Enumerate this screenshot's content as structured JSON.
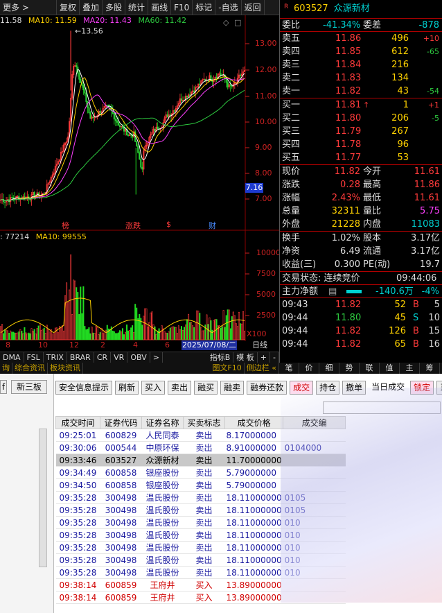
{
  "toolbar": {
    "more": "更多 >",
    "buttons": [
      "复权",
      "叠加",
      "多股",
      "统计",
      "画线",
      "F10",
      "标记",
      "-自选",
      "返回"
    ]
  },
  "ma_legend": {
    "ma5": "11.58",
    "ma10": "MA10: 11.59",
    "ma20": "MA20: 11.43",
    "ma60": "MA60: 11.42"
  },
  "price_axis": [
    "13.00",
    "12.00",
    "11.00",
    "10.00",
    "9.00",
    "8.00",
    "7.00"
  ],
  "high_label": "13.56",
  "last_price_chip": "7.16",
  "event_markers": [
    "榜",
    "涨跌",
    "$",
    "财"
  ],
  "vol_legend": {
    "v1": ": 77214",
    "v2": "MA10: 99555"
  },
  "vol_axis": [
    "10000",
    "7500",
    "5000",
    "2500",
    "X100"
  ],
  "x_ticks": [
    "8",
    "10",
    "12",
    "2",
    "4",
    "6"
  ],
  "date_chip": "2025/07/08/二",
  "day_label": "日线",
  "indicators": [
    "DMA",
    "FSL",
    "TRIX",
    "BRAR",
    "CR",
    "VR",
    "OBV",
    ">",
    "指标B",
    "模 板",
    "+",
    "-"
  ],
  "tabs": [
    "询",
    "综合资讯",
    "板块资讯",
    "图文F10",
    "侧边栏 «"
  ],
  "quote": {
    "code": "603527",
    "name": "众源新材",
    "ratio_label": "委比",
    "ratio": "-41.34%",
    "diff_label": "委差",
    "diff": "-878",
    "asks": [
      {
        "label": "卖五",
        "price": "11.86",
        "vol": "496",
        "chg": "+10"
      },
      {
        "label": "卖四",
        "price": "11.85",
        "vol": "612",
        "chg": "-65"
      },
      {
        "label": "卖三",
        "price": "11.84",
        "vol": "216",
        "chg": ""
      },
      {
        "label": "卖二",
        "price": "11.83",
        "vol": "134",
        "chg": ""
      },
      {
        "label": "卖一",
        "price": "11.82",
        "vol": "43",
        "chg": "-54"
      }
    ],
    "bids": [
      {
        "label": "买一",
        "price": "11.81",
        "vol": "1",
        "chg": "+1"
      },
      {
        "label": "买二",
        "price": "11.80",
        "vol": "206",
        "chg": "-5"
      },
      {
        "label": "买三",
        "price": "11.79",
        "vol": "267",
        "chg": ""
      },
      {
        "label": "买四",
        "price": "11.78",
        "vol": "96",
        "chg": ""
      },
      {
        "label": "买五",
        "price": "11.77",
        "vol": "53",
        "chg": ""
      }
    ],
    "stats": [
      {
        "l1": "现价",
        "v1": "11.82",
        "l2": "今开",
        "v2": "11.61"
      },
      {
        "l1": "涨跌",
        "v1": "0.28",
        "l2": "最高",
        "v2": "11.86"
      },
      {
        "l1": "涨幅",
        "v1": "2.43%",
        "l2": "最低",
        "v2": "11.61"
      },
      {
        "l1": "总量",
        "v1": "32311",
        "l2": "量比",
        "v2": "5.75"
      },
      {
        "l1": "外盘",
        "v1": "21228",
        "l2": "内盘",
        "v2": "11083"
      }
    ],
    "stats2": [
      {
        "l1": "换手",
        "v1": "1.02%",
        "l2": "股本",
        "v2": "3.17亿"
      },
      {
        "l1": "净资",
        "v1": "6.49",
        "l2": "流通",
        "v2": "3.17亿"
      },
      {
        "l1": "收益(三)",
        "v1": "0.300",
        "l2": "PE(动)",
        "v2": "19.7"
      }
    ],
    "status_label": "交易状态: 连续竞价",
    "status_time": "09:44:06",
    "main_flow_label": "主力净额",
    "main_flow": "-140.6万",
    "main_flow_pct": "-4%",
    "ticks": [
      {
        "time": "09:43",
        "price": "11.82",
        "vol": "52",
        "side": "B",
        "n": "5"
      },
      {
        "time": "09:44",
        "price": "11.80",
        "vol": "45",
        "side": "S",
        "n": "10"
      },
      {
        "time": "09:44",
        "price": "11.82",
        "vol": "126",
        "side": "B",
        "n": "15"
      },
      {
        "time": "09:44",
        "price": "11.82",
        "vol": "65",
        "side": "B",
        "n": "16"
      }
    ]
  },
  "rp_tabs": [
    "笔",
    "价",
    "细",
    "势",
    "联",
    "值",
    "主",
    "筹"
  ],
  "bottom": {
    "left_buttons": [
      "f",
      "新三板"
    ],
    "buttons": [
      "安全信息提示",
      "刷新",
      "买入",
      "卖出",
      "融买",
      "融卖",
      "融券还款",
      "成交",
      "持仓",
      "撤单",
      "当日成交",
      "锁定",
      "系统"
    ],
    "columns": [
      "成交时间",
      "证券代码",
      "证券名称",
      "买卖标志",
      "成交价格",
      "成交编"
    ],
    "rows": [
      {
        "time": "09:25:01",
        "code": "600829",
        "name": "人民同泰",
        "flag": "卖出",
        "price": "8.17000000",
        "extra": "",
        "type": "blue"
      },
      {
        "time": "09:30:06",
        "code": "000544",
        "name": "中原环保",
        "flag": "卖出",
        "price": "8.91000000",
        "extra": "0104000",
        "type": "blue"
      },
      {
        "time": "09:33:46",
        "code": "603527",
        "name": "众源新材",
        "flag": "卖出",
        "price": "11.70000000",
        "extra": "",
        "type": "sel"
      },
      {
        "time": "09:34:49",
        "code": "600858",
        "name": "银座股份",
        "flag": "卖出",
        "price": "5.79000000",
        "extra": "",
        "type": "blue"
      },
      {
        "time": "09:34:50",
        "code": "600858",
        "name": "银座股份",
        "flag": "卖出",
        "price": "5.79000000",
        "extra": "",
        "type": "blue"
      },
      {
        "time": "09:35:28",
        "code": "300498",
        "name": "温氏股份",
        "flag": "卖出",
        "price": "18.11000000",
        "extra": "0105",
        "type": "blue"
      },
      {
        "time": "09:35:28",
        "code": "300498",
        "name": "温氏股份",
        "flag": "卖出",
        "price": "18.11000000",
        "extra": "0105",
        "type": "blue"
      },
      {
        "time": "09:35:28",
        "code": "300498",
        "name": "温氏股份",
        "flag": "卖出",
        "price": "18.11000000",
        "extra": "010",
        "type": "blue"
      },
      {
        "time": "09:35:28",
        "code": "300498",
        "name": "温氏股份",
        "flag": "卖出",
        "price": "18.11000000",
        "extra": "010",
        "type": "blue"
      },
      {
        "time": "09:35:28",
        "code": "300498",
        "name": "温氏股份",
        "flag": "卖出",
        "price": "18.11000000",
        "extra": "010",
        "type": "blue"
      },
      {
        "time": "09:35:28",
        "code": "300498",
        "name": "温氏股份",
        "flag": "卖出",
        "price": "18.11000000",
        "extra": "010",
        "type": "blue"
      },
      {
        "time": "09:35:28",
        "code": "300498",
        "name": "温氏股份",
        "flag": "卖出",
        "price": "18.11000000",
        "extra": "010",
        "type": "blue"
      },
      {
        "time": "09:38:14",
        "code": "600859",
        "name": "王府井",
        "flag": "买入",
        "price": "13.89000000",
        "extra": "",
        "type": "buy"
      },
      {
        "time": "09:38:14",
        "code": "600859",
        "name": "王府井",
        "flag": "买入",
        "price": "13.89000000",
        "extra": "",
        "type": "buy"
      }
    ]
  },
  "colors": {
    "up": "#ff3b3b",
    "down": "#2ecc40",
    "accent": "#ffd200"
  }
}
